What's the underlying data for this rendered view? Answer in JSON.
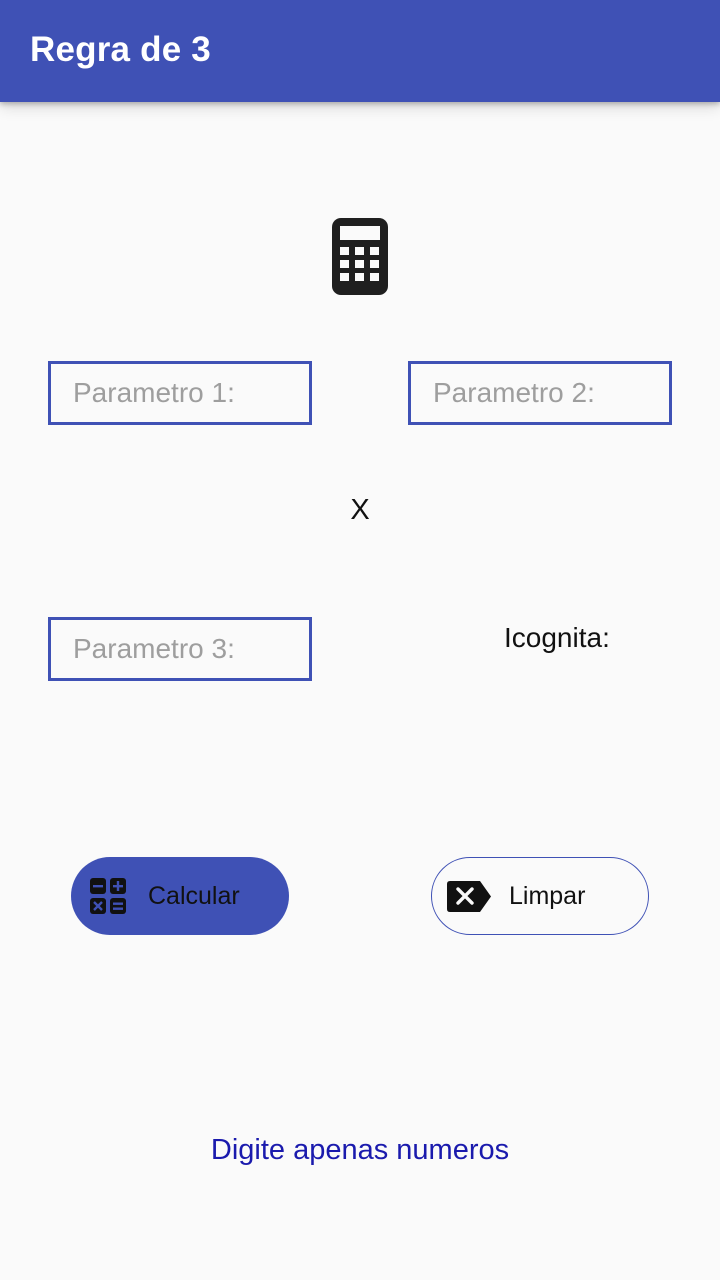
{
  "appbar": {
    "title": "Regra de 3",
    "color": "#3f51b5"
  },
  "header_icon": "calculator-icon",
  "form": {
    "param1": {
      "placeholder": "Parametro 1:",
      "value": ""
    },
    "param2": {
      "placeholder": "Parametro 2:",
      "value": ""
    },
    "operator": "X",
    "param3": {
      "placeholder": "Parametro 3:",
      "value": ""
    },
    "incognita_label": "Icognita:"
  },
  "buttons": {
    "calculate": {
      "label": "Calcular",
      "icon": "calculate-icon"
    },
    "clear": {
      "label": "Limpar",
      "icon": "backspace-icon"
    }
  },
  "hint": "Digite apenas numeros"
}
